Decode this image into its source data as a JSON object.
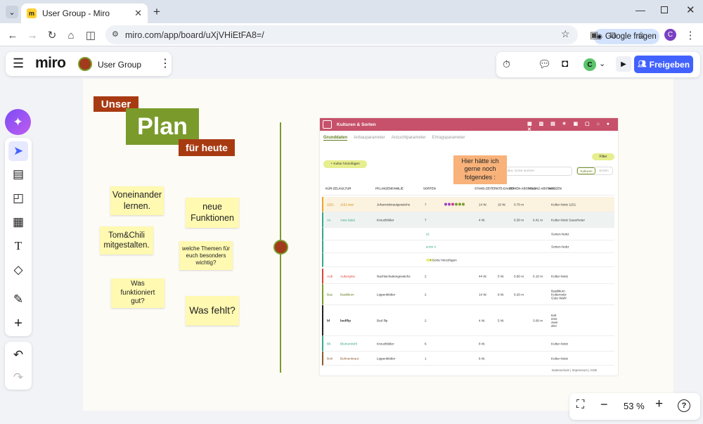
{
  "browser": {
    "tab_title": "User Group - Miro",
    "tab_favicon": "miro",
    "url": "miro.com/app/board/uXjVHiEtFA8=/",
    "google_button": "Google fragen",
    "avatar_letter": "C"
  },
  "miro": {
    "logo": "miro",
    "board_name": "User Group",
    "avatar_letter": "C",
    "share_label": "Freigeben",
    "zoom": "53 %",
    "accent_color": "#4262ff"
  },
  "board": {
    "title_unser": "Unser",
    "title_plan": "Plan",
    "title_heute": "für heute",
    "stickies": [
      "Voneinander lernen.",
      "neue Funktionen",
      "Tom&Chili mitgestalten.",
      "welche Themen für euch besonders wichtig?",
      "Was funktioniert gut?",
      "Was fehlt?"
    ],
    "note_orange": "Hier hätte ich gerne noch folgendes :"
  },
  "screenshot": {
    "header_title": "Kulturen & Sorten",
    "tabs": [
      "Grunddaten",
      "Anbauparameter",
      "Anzuchtparameter",
      "Ertragsparameter"
    ],
    "filter_label": "Filter",
    "add_culture": "+ Kultur hinzufügen",
    "search_placeholder": "Kultur, Sorte suchen",
    "toggle_left": "Kulturen",
    "toggle_right": "Sorten",
    "columns": [
      "KÜR-ZEL",
      "KULTUR",
      "PFLANZENFAMILIE",
      "SORTEN",
      "STAND-ZEIT",
      "ERNTE-DAUER",
      "REIHEN-ABSTAND",
      "PFLANZ-ABSTAND",
      "NOTIZEN"
    ],
    "rows": [
      {
        "code": "1151",
        "culture": "1151-test",
        "family": "Johannisbrautgewächs",
        "sorten": "7",
        "stand": "14 W.",
        "ernte": "10 W.",
        "reihen": "0.70 m",
        "pflanz": "",
        "notes": "Kultur-Notiz 1151"
      },
      {
        "code": "As",
        "culture": "Asia-Salat",
        "family": "Kreuzblütler",
        "sorten": "7",
        "stand": "4 W.",
        "ernte": "",
        "reihen": "0.30 m",
        "pflanz": "0.41 m",
        "notes": "Kultur-Notiz Sauerheter"
      },
      {
        "code": "",
        "culture": "",
        "family": "",
        "sorten": "s2",
        "stand": "",
        "ernte": "",
        "reihen": "",
        "pflanz": "",
        "notes": "Sorten-Notiz"
      },
      {
        "code": "",
        "culture": "",
        "family": "",
        "sorten": "sorte 4",
        "stand": "",
        "ernte": "",
        "reihen": "",
        "pflanz": "",
        "notes": "Sorten-Notiz"
      },
      {
        "code": "Aub",
        "culture": "Aubergine",
        "family": "Nachtschattengewächs",
        "sorten": "2",
        "stand": "44 W.",
        "ernte": "5 W.",
        "reihen": "0.60 m",
        "pflanz": "0.10 m",
        "notes": "Kultur-Notiz"
      },
      {
        "code": "Bas",
        "culture": "Basilikum",
        "family": "Lippenblütler",
        "sorten": "2",
        "stand": "14 W.",
        "ernte": "9 W.",
        "reihen": "0.20 m",
        "pflanz": "",
        "notes": "Basilikum Kulturnotiz Gute Wahl"
      },
      {
        "code": "bf",
        "culture": "bedflip",
        "family": "Bed flip",
        "sorten": "2",
        "stand": "4 W.",
        "ernte": "5 W.",
        "reihen": "",
        "pflanz": "3.00 m",
        "notes": "test eins zwei drei"
      },
      {
        "code": "Bk",
        "culture": "Blumenkohl",
        "family": "Kreuzblütler",
        "sorten": "6",
        "stand": "8 W.",
        "ernte": "",
        "reihen": "",
        "pflanz": "",
        "notes": "Kultur-Notiz"
      },
      {
        "code": "Boh",
        "culture": "Bohnenkraut",
        "family": "Lippenblütler",
        "sorten": "1",
        "stand": "6 W.",
        "ernte": "",
        "reihen": "",
        "pflanz": "",
        "notes": "Kultur-Notiz"
      }
    ],
    "add_sorte": "+ Sorte hinzufügen",
    "footer": "Datenschutz | Impressum | AGB"
  }
}
